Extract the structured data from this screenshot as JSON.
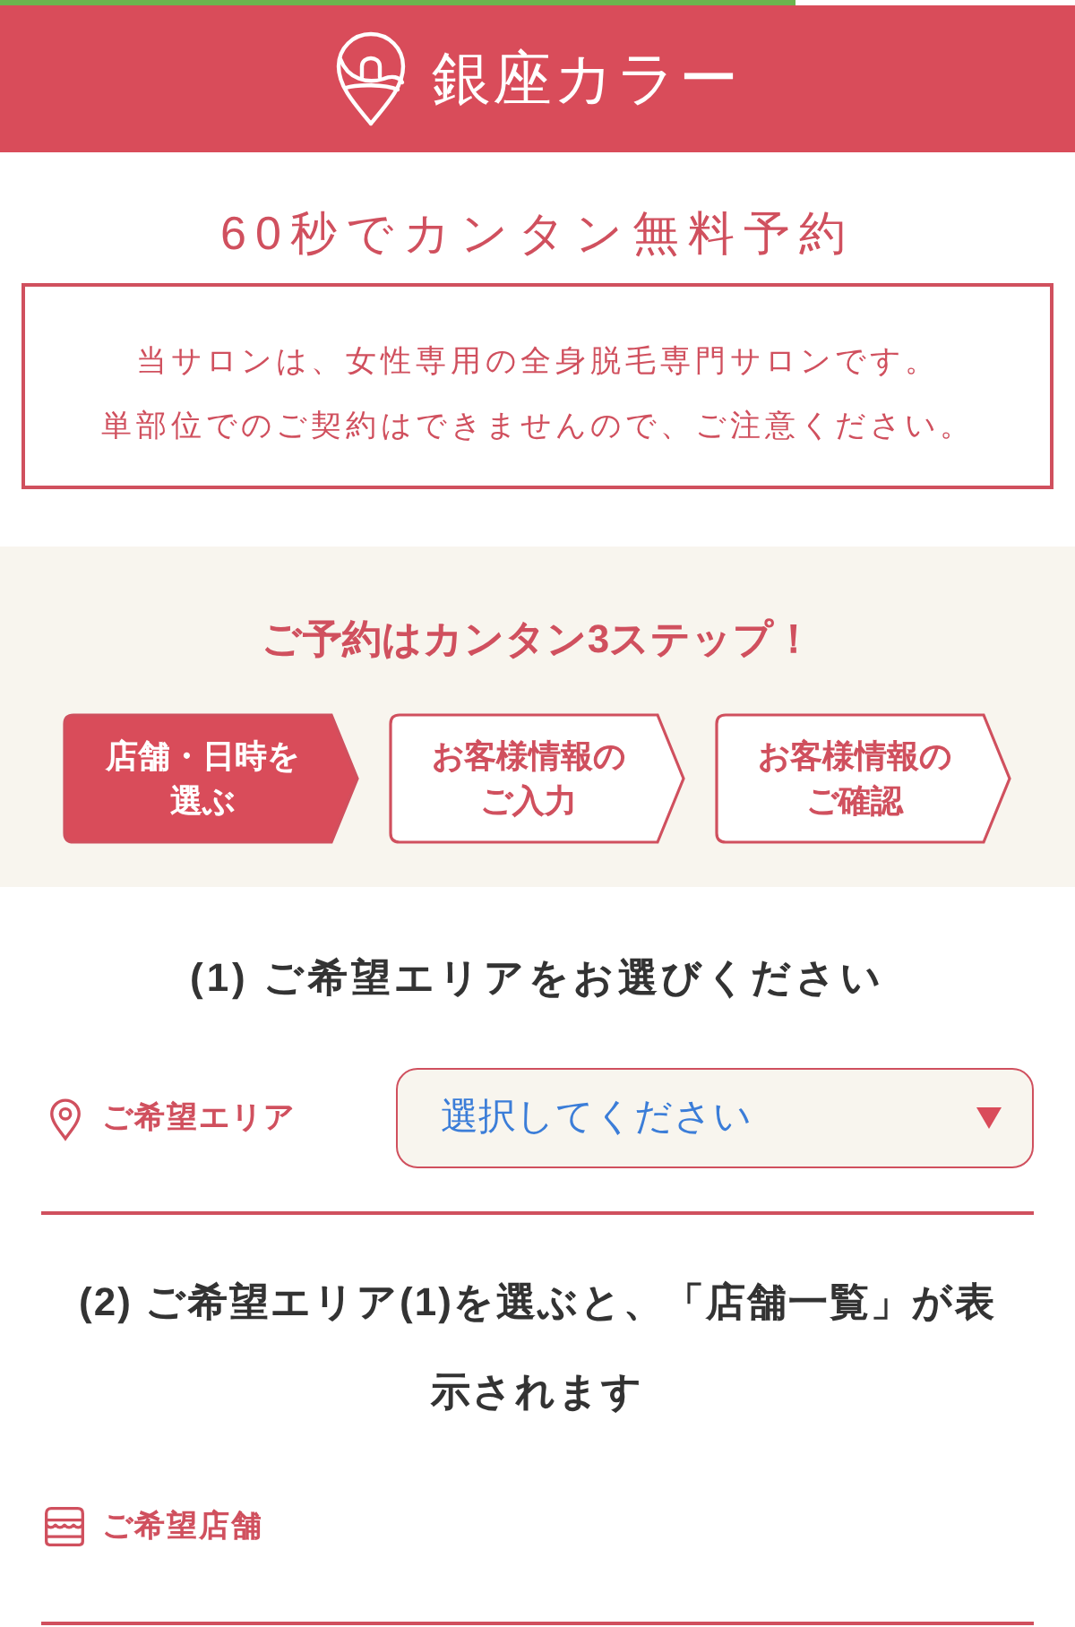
{
  "loading_bar": {
    "level": 0.74
  },
  "header": {
    "brand": "銀座カラー"
  },
  "title": "60秒でカンタン無料予約",
  "notice": [
    "当サロンは、女性専用の全身脱毛専門サロンです。",
    "単部位でのご契約はできませんので、ご注意ください。"
  ],
  "steps_section": {
    "heading": "ご予約はカンタン3ステップ！",
    "steps": [
      {
        "label": "店舗・日時を選ぶ",
        "selected": true
      },
      {
        "label": "お客様情報のご入力",
        "selected": false
      },
      {
        "label": "お客様情報のご確認",
        "selected": false
      }
    ]
  },
  "sections": [
    {
      "heading": "(1) ご希望エリアをお選びください",
      "field": {
        "kind": "area",
        "label": "ご希望エリア",
        "placeholder": "選択してください"
      }
    },
    {
      "heading": "(2) ご希望エリア(1)を選ぶと、「店舗一覧」が表示されます",
      "field": {
        "kind": "store",
        "label": "ご希望店舗"
      }
    }
  ]
}
